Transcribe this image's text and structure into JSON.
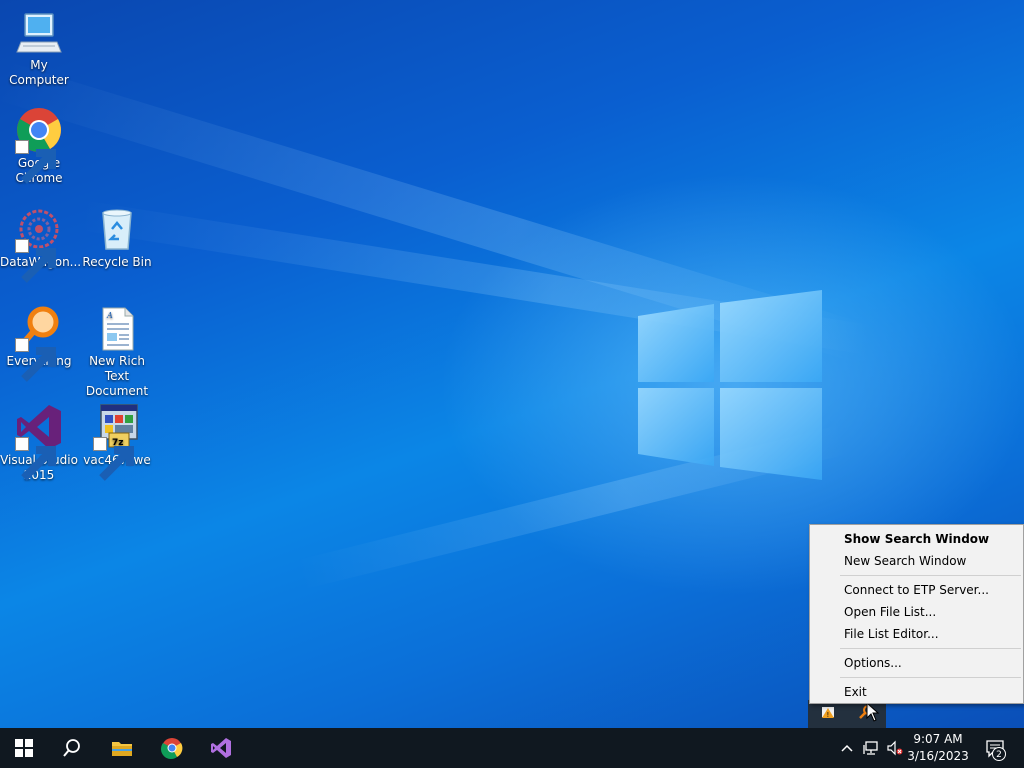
{
  "desktop": {
    "icons": [
      {
        "label": "My Computer",
        "icon": "computer-icon"
      },
      {
        "label": "Google Chrome",
        "icon": "chrome-icon"
      },
      {
        "label": "DataWagon...",
        "icon": "datawagon-icon"
      },
      {
        "label": "Recycle Bin",
        "icon": "recycle-bin-icon"
      },
      {
        "label": "Everything",
        "icon": "everything-icon"
      },
      {
        "label": "New Rich Text Document",
        "icon": "rich-text-document-icon"
      },
      {
        "label": "Visual Studio 2015",
        "icon": "visual-studio-icon"
      },
      {
        "label": "vac467swe",
        "icon": "installer-icon"
      }
    ]
  },
  "context_menu": {
    "items": [
      {
        "label": "Show Search Window",
        "bold": true
      },
      {
        "label": "New Search Window"
      },
      {
        "label": "Connect to ETP Server..."
      },
      {
        "label": "Open File List..."
      },
      {
        "label": "File List Editor..."
      },
      {
        "label": "Options..."
      },
      {
        "label": "Exit"
      }
    ]
  },
  "taskbar": {
    "pinned": [
      "start-icon",
      "search-icon",
      "file-explorer-icon",
      "chrome-icon",
      "visual-studio-icon"
    ],
    "tray": [
      "show-hidden-icons-chevron-icon",
      "network-icon",
      "volume-muted-icon"
    ],
    "clock": {
      "time": "9:07 AM",
      "date": "3/16/2023"
    },
    "notification_count": "2"
  },
  "colors": {
    "taskbar": "#101820",
    "menu_background": "#f2f2f2",
    "desktop_blue": "#0b86e6"
  }
}
